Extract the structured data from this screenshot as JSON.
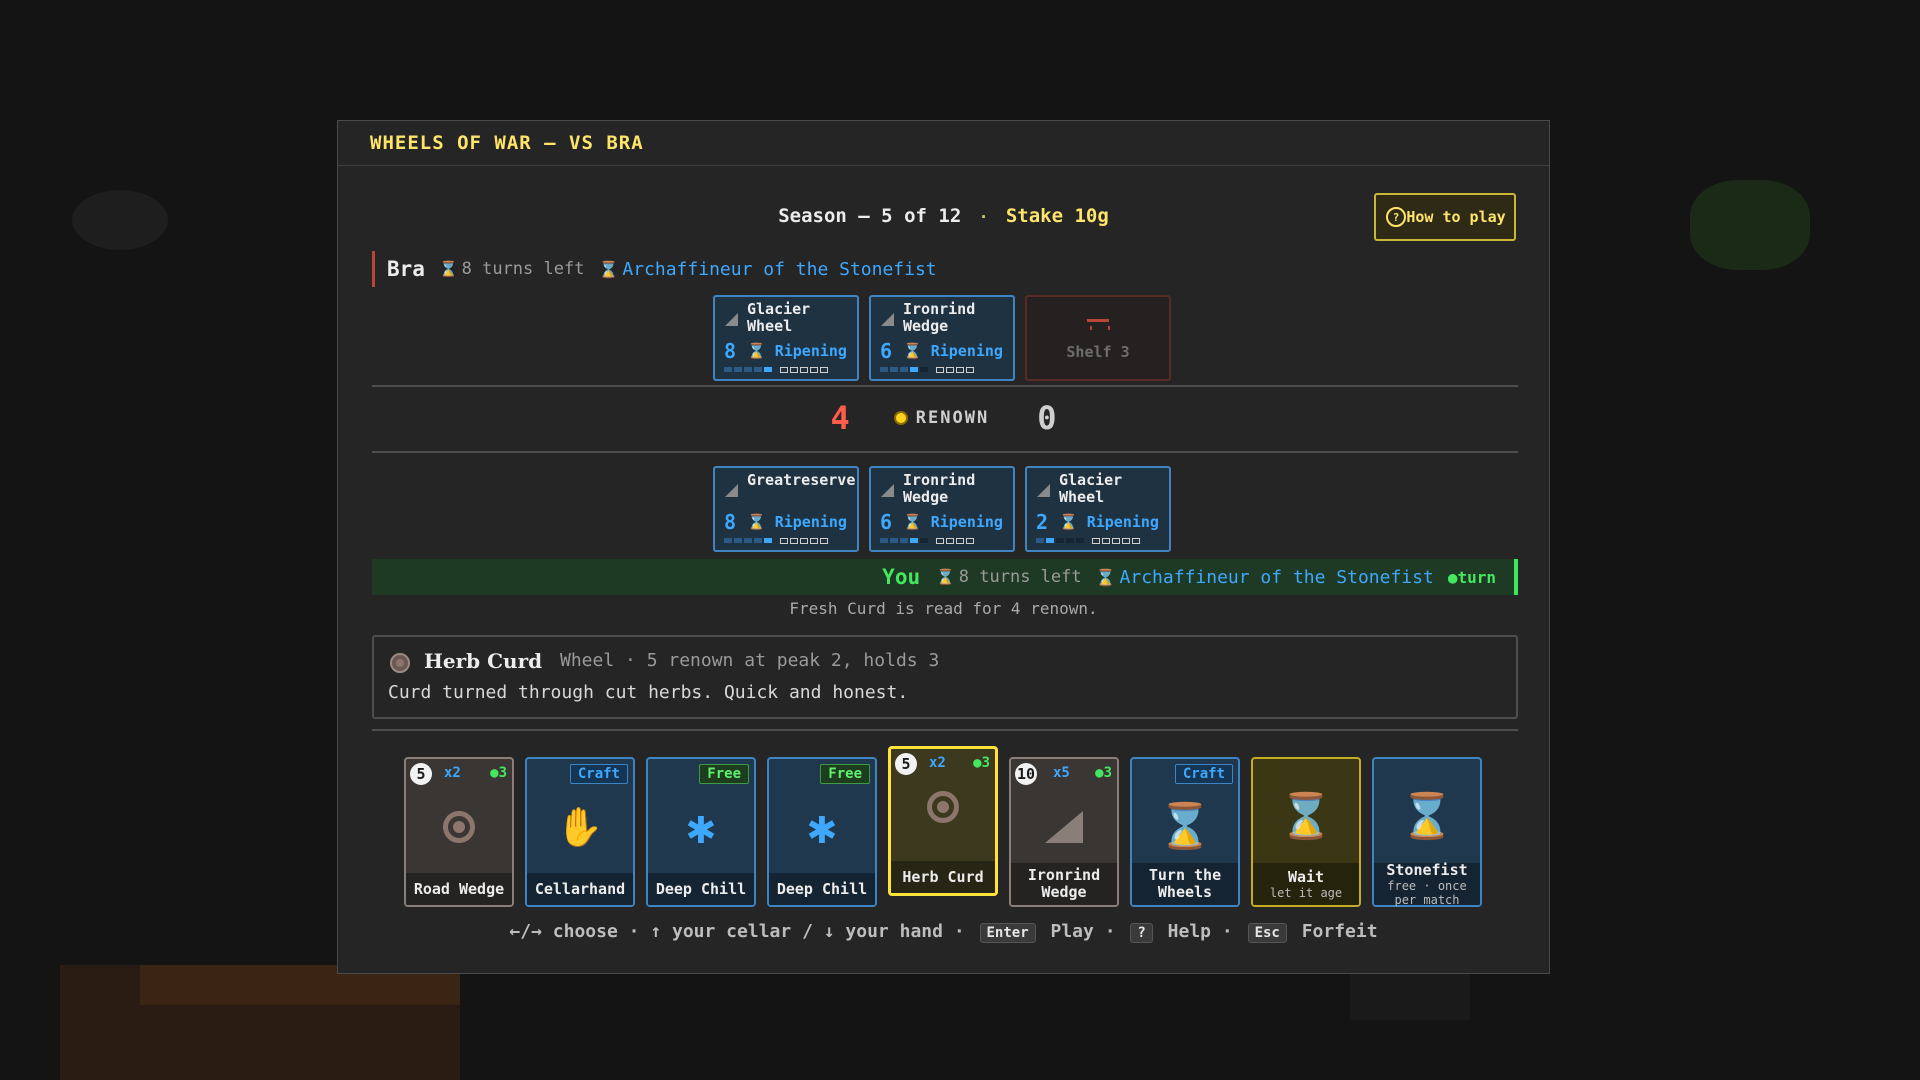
{
  "modal": {
    "title": "WHEELS OF WAR — VS BRA"
  },
  "season": {
    "text": "Season — 5 of 12",
    "sep": "·",
    "stake": "Stake 10g"
  },
  "help_button": {
    "label": "How to play",
    "icon": "?"
  },
  "opponent": {
    "name": "Bra",
    "turns": "8 turns left",
    "title": "Archaffineur of the Stonefist",
    "shelf": [
      {
        "name": "Glacier Wheel",
        "value": "8",
        "status": "Ripening",
        "fill": [
          1,
          1,
          1,
          1,
          1
        ],
        "boxes": 5
      },
      {
        "name": "Ironrind Wedge",
        "value": "6",
        "status": "Ripening",
        "fill": [
          1,
          1,
          1,
          1
        ],
        "boxes": 4
      }
    ],
    "empty_shelf_label": "Shelf 3",
    "score": "4"
  },
  "renown": {
    "label": "RENOWN"
  },
  "you": {
    "name": "You",
    "turns": "8 turns left",
    "title": "Archaffineur of the Stonefist",
    "turn_marker": "●turn",
    "score": "0",
    "shelf": [
      {
        "name": "Greatreserve",
        "value": "8",
        "status": "Ripening",
        "fill": [
          1,
          1,
          1,
          1,
          1
        ],
        "boxes": 5
      },
      {
        "name": "Ironrind Wedge",
        "value": "6",
        "status": "Ripening",
        "fill": [
          1,
          1,
          1,
          1
        ],
        "boxes": 4
      },
      {
        "name": "Glacier Wheel",
        "value": "2",
        "status": "Ripening",
        "fill": [
          1,
          1
        ],
        "boxes": 5
      }
    ]
  },
  "log": {
    "text": "Fresh Curd is read for 4 renown."
  },
  "info": {
    "name": "Herb Curd",
    "meta": "Wheel · 5 renown at peak 2, holds 3",
    "desc": "Curd turned through cut herbs. Quick and honest."
  },
  "hand": [
    {
      "kind": "cheese",
      "label": "Road Wedge",
      "cost": "5",
      "x": "x2",
      "o": "●3",
      "icon": "wheel-icon"
    },
    {
      "kind": "spell",
      "label": "Cellarhand",
      "tag": "Craft",
      "icon": "hand-icon"
    },
    {
      "kind": "spell",
      "label": "Deep Chill",
      "tag": "Free",
      "icon": "snowflake-icon"
    },
    {
      "kind": "spell",
      "label": "Deep Chill",
      "tag": "Free",
      "icon": "snowflake-icon"
    },
    {
      "kind": "selected",
      "label": "Herb Curd",
      "cost": "5",
      "x": "x2",
      "o": "●3",
      "icon": "wheel-icon"
    },
    {
      "kind": "cheese",
      "label": "Ironrind Wedge",
      "cost": "10",
      "x": "x5",
      "o": "●3",
      "icon": "wedge-icon"
    },
    {
      "kind": "spell",
      "label": "Turn the Wheels",
      "tag": "Craft",
      "icon": "hourglass-icon"
    },
    {
      "kind": "wait",
      "label": "Wait",
      "sub": "let it age",
      "icon": "hourglass-icon"
    },
    {
      "kind": "spell",
      "label": "Stonefist",
      "sub": "free · once per match",
      "icon": "hourglass-icon"
    }
  ],
  "footer": {
    "choose": "←/→ choose",
    "cellar": "↑ your cellar",
    "slash": "/",
    "handtxt": "↓ your hand",
    "enter_key": "Enter",
    "play": "Play",
    "help_key": "?",
    "help": "Help",
    "esc_key": "Esc",
    "forfeit": "Forfeit",
    "dot": "·"
  },
  "colors": {
    "accent": "#ffe46a",
    "blue": "#3ea8ff",
    "green": "#43e85e",
    "red": "#ff5d4a"
  }
}
